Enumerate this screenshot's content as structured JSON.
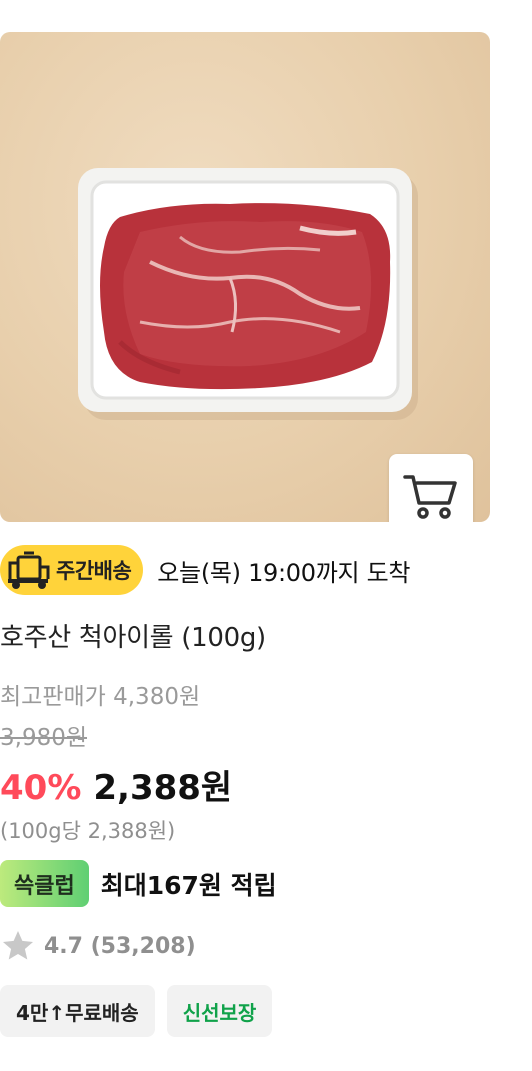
{
  "product": {
    "image_alt": "호주산 척아이롤 (100g)",
    "delivery_badge": "주간배송",
    "arrival_text": "오늘(목) 19:00까지 도착",
    "title": "호주산 척아이롤 (100g)",
    "best_price_label": "최고판매가 4,380원",
    "original_price": "3,980원",
    "discount_rate": "40%",
    "sale_price": "2,388원",
    "unit_price": "(100g당 2,388원)",
    "club_badge": "쓱클럽",
    "reward_text": "최대167원 적립",
    "rating": "4.7 (53,208)",
    "tags": [
      "4만↑무료배송",
      "신선보장"
    ]
  },
  "colors": {
    "delivery_badge_bg": "#ffd33a",
    "discount": "#ff4a5a",
    "fresh_tag_text": "#10a24a",
    "club_gradient_start": "#bdea7d",
    "club_gradient_end": "#5fcf73"
  },
  "icons": {
    "cart": "cart-icon",
    "delivery_truck": "truck-icon",
    "rating": "star-icon"
  }
}
